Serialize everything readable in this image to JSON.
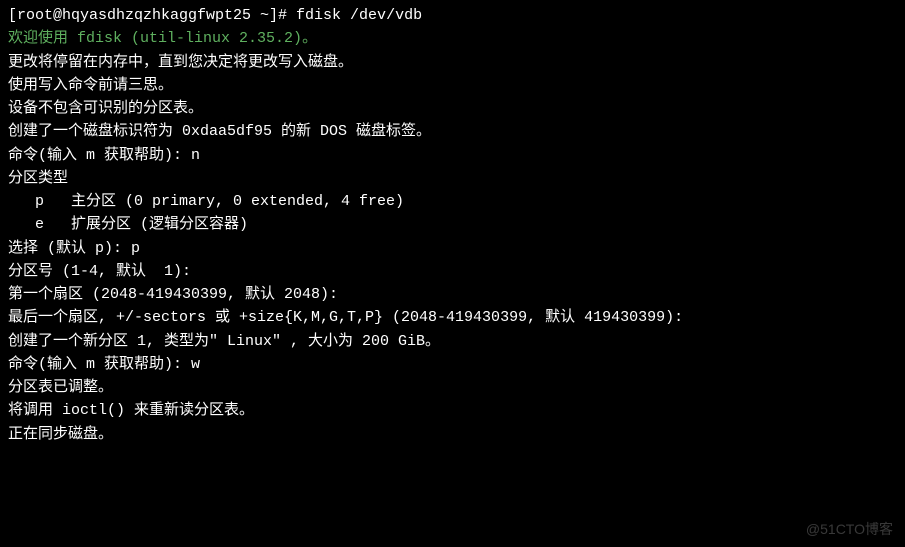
{
  "prompt": {
    "left": "[root@hqyasdhzqzhkaggfwpt25 ~]#",
    "cmd": " fdisk /dev/vdb"
  },
  "blank1": "",
  "welcome_prefix": "欢迎使用 ",
  "welcome_fdisk": "fdisk (util-linux 2.35.2)",
  "welcome_suffix": "。",
  "info1": "更改将停留在内存中，直到您决定将更改写入磁盘。",
  "info2": "使用写入命令前请三思。",
  "blank2": "",
  "info3": "设备不包含可识别的分区表。",
  "info4": "创建了一个磁盘标识符为 0xdaa5df95 的新 DOS 磁盘标签。",
  "blank3": "",
  "cmd_prompt1": "命令(输入 m 获取帮助): n",
  "part_type_header": "分区类型",
  "part_p": "   p   主分区 (0 primary, 0 extended, 4 free)",
  "part_e": "   e   扩展分区 (逻辑分区容器)",
  "select": "选择 (默认 p): p",
  "part_num": "分区号 (1-4, 默认  1): ",
  "first_sector": "第一个扇区 (2048-419430399, 默认 2048): ",
  "last_sector": "最后一个扇区, +/-sectors 或 +size{K,M,G,T,P} (2048-419430399, 默认 419430399): ",
  "blank4": "",
  "created": "创建了一个新分区 1, 类型为\" Linux\" , 大小为 200 GiB。",
  "blank5": "",
  "cmd_prompt2": "命令(输入 m 获取帮助): w",
  "adjusted": "分区表已调整。",
  "ioctl": "将调用 ioctl() 来重新读分区表。",
  "syncing": "正在同步磁盘。",
  "watermark": "@51CTO博客"
}
